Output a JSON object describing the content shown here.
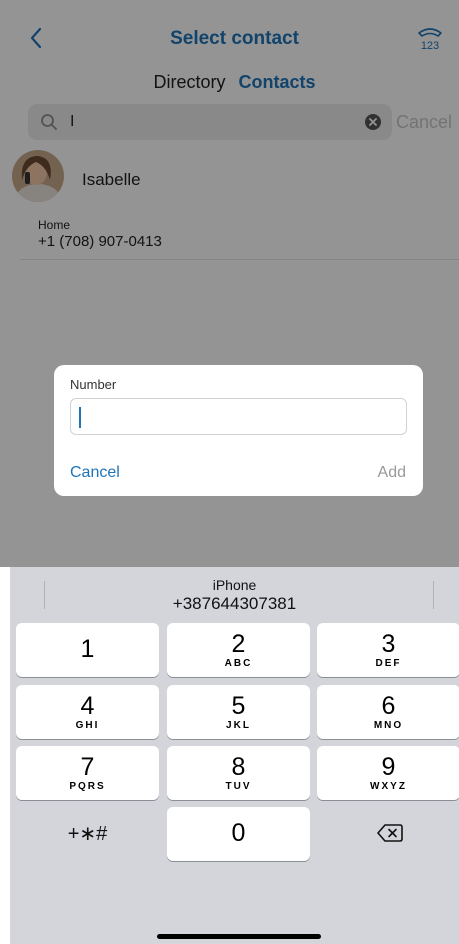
{
  "header": {
    "title": "Select contact",
    "back_icon": "chevron-left-icon",
    "dialpad_icon": "keypad-phone-icon"
  },
  "segment": {
    "directory_label": "Directory",
    "contacts_label": "Contacts",
    "selected": "Contacts"
  },
  "search": {
    "value": "I",
    "cancel_label": "Cancel",
    "icon": "search-icon",
    "clear_icon": "clear-circle-icon"
  },
  "contact": {
    "name": "Isabelle",
    "phone_type": "Home",
    "phone_number": "+1 (708) 907-0413"
  },
  "dialog": {
    "label": "Number",
    "input_value": "",
    "cancel_label": "Cancel",
    "add_label": "Add"
  },
  "keyboard": {
    "suggestion_label": "iPhone",
    "suggestion_number": "+387644307381",
    "keys": [
      {
        "digit": "1",
        "letters": ""
      },
      {
        "digit": "2",
        "letters": "ABC"
      },
      {
        "digit": "3",
        "letters": "DEF"
      },
      {
        "digit": "4",
        "letters": "GHI"
      },
      {
        "digit": "5",
        "letters": "JKL"
      },
      {
        "digit": "6",
        "letters": "MNO"
      },
      {
        "digit": "7",
        "letters": "PQRS"
      },
      {
        "digit": "8",
        "letters": "TUV"
      },
      {
        "digit": "9",
        "letters": "WXYZ"
      },
      {
        "digit": "0",
        "letters": ""
      }
    ],
    "symbols_label": "+∗#",
    "backspace_icon": "backspace-icon"
  },
  "colors": {
    "accent": "#1f74b8",
    "keyboard_bg": "#d3d5db",
    "muted": "#9a9a9a"
  }
}
